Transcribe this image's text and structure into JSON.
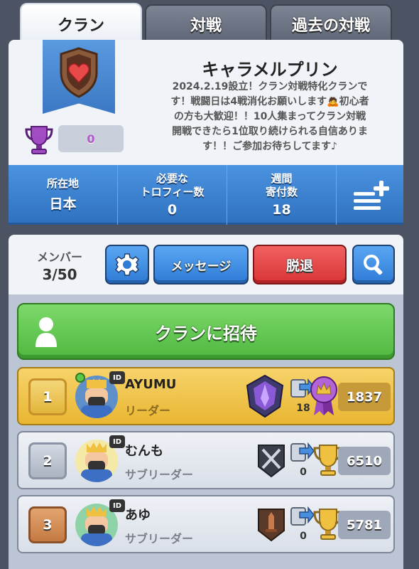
{
  "tabs": [
    {
      "label": "クラン",
      "active": true
    },
    {
      "label": "対戦",
      "active": false
    },
    {
      "label": "過去の対戦",
      "active": false
    }
  ],
  "clan": {
    "name": "キャラメルプリン",
    "description_lines": [
      "2024.2.19設立！クラン対戦特化クランで",
      "す！戦闘日は4戦消化お願いします🙇初心者",
      "の方も大歓迎！！10人集まってクラン対戦",
      "開戦できたら1位取り続けられる自信ありま",
      "す！！ご参加お待ちしてます♪"
    ],
    "trophies": "0",
    "badge_icon": "heart-crest-icon"
  },
  "stats": {
    "location_label": "所在地",
    "location_value": "日本",
    "required_label_1": "必要な",
    "required_label_2": "トロフィー数",
    "required_value": "0",
    "donations_label_1": "週間",
    "donations_label_2": "寄付数",
    "donations_value": "18"
  },
  "actions": {
    "members_label": "メンバー",
    "members_count": "3/50",
    "message_label": "メッセージ",
    "leave_label": "脱退",
    "invite_label": "クランに招待"
  },
  "members": [
    {
      "rank": "1",
      "name": "AYUMU",
      "role": "リーダー",
      "donations": "18",
      "score": "1837",
      "online": true,
      "id_tag": "ID"
    },
    {
      "rank": "2",
      "name": "むんも",
      "role": "サブリーダー",
      "donations": "0",
      "score": "6510",
      "online": false,
      "id_tag": "ID"
    },
    {
      "rank": "3",
      "name": "あゆ",
      "role": "サブリーダー",
      "donations": "0",
      "score": "5781",
      "online": false,
      "id_tag": "ID"
    }
  ],
  "colors": {
    "accent_blue": "#3b82d6",
    "leave_red": "#e04446",
    "invite_green": "#5cc84a",
    "gold_row": "#f0c34c"
  }
}
